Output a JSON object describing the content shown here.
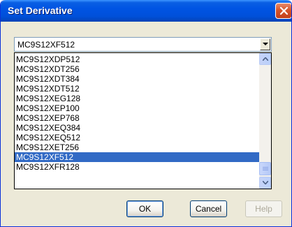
{
  "window": {
    "title": "Set Derivative"
  },
  "combo": {
    "value": "MC9S12XF512"
  },
  "list": {
    "items": [
      "MC9S12XDP512",
      "MC9S12XDT256",
      "MC9S12XDT384",
      "MC9S12XDT512",
      "MC9S12XEG128",
      "MC9S12XEP100",
      "MC9S12XEP768",
      "MC9S12XEQ384",
      "MC9S12XEQ512",
      "MC9S12XET256",
      "MC9S12XF512",
      "MC9S12XFR128"
    ],
    "selected_index": 10
  },
  "buttons": {
    "ok": "OK",
    "cancel": "Cancel",
    "help": "Help"
  },
  "colors": {
    "title_bar": "#0054e3",
    "selection": "#316ac5",
    "close_button": "#d6542a"
  },
  "icons": {
    "close": "close-icon",
    "dropdown": "chevron-down-icon",
    "scroll_up": "arrow-up-icon",
    "scroll_down": "arrow-down-icon"
  }
}
